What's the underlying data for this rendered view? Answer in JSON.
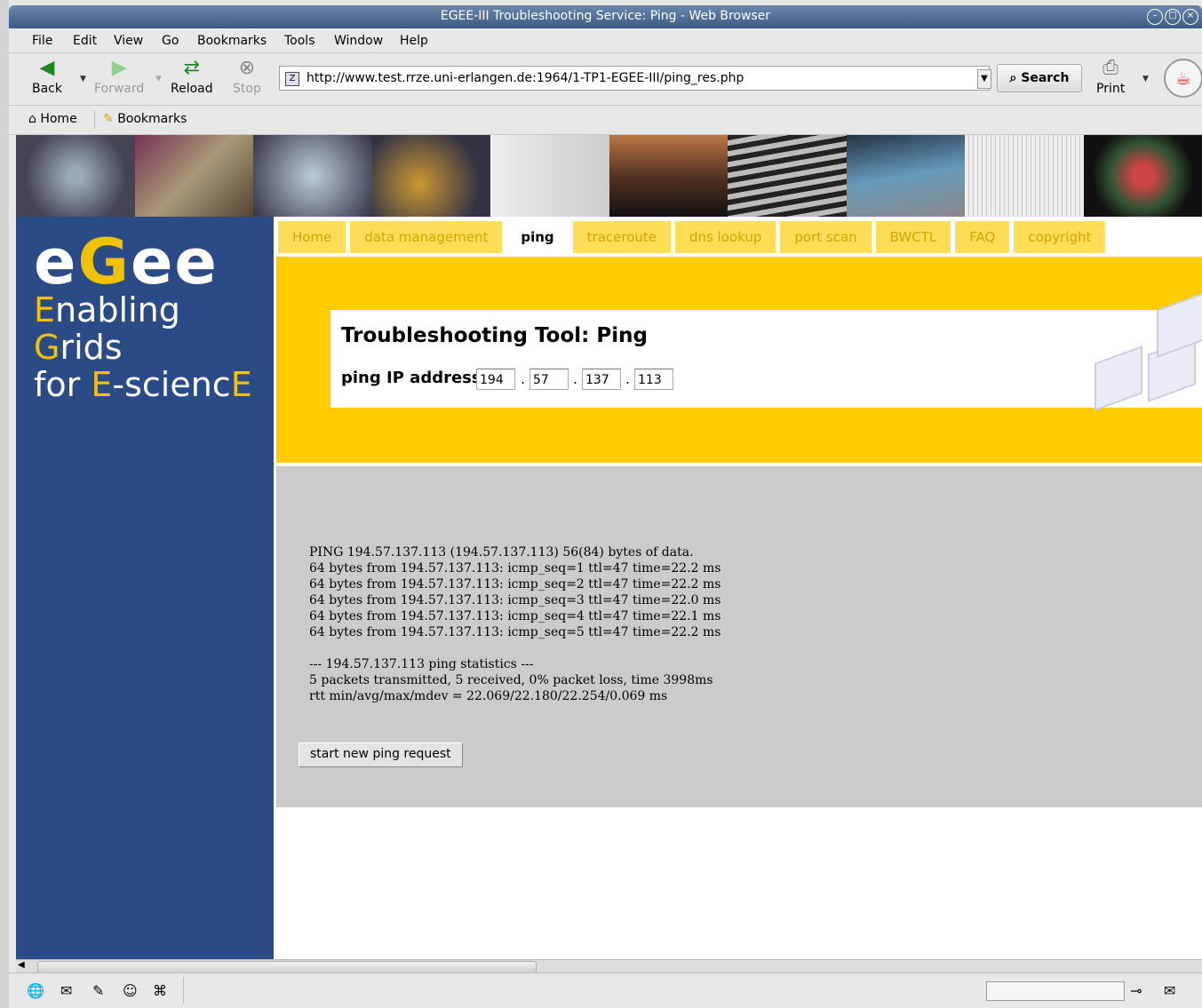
{
  "window": {
    "title": "EGEE-III Troubleshooting Service: Ping - Web Browser",
    "controls": [
      "minimize",
      "maximize",
      "close"
    ]
  },
  "menu": [
    {
      "label": "File"
    },
    {
      "label": "Edit"
    },
    {
      "label": "View"
    },
    {
      "label": "Go"
    },
    {
      "label": "Bookmarks"
    },
    {
      "label": "Tools"
    },
    {
      "label": "Window"
    },
    {
      "label": "Help"
    }
  ],
  "toolbar": {
    "back": "Back",
    "forward": "Forward",
    "reload": "Reload",
    "stop": "Stop",
    "url": "http://www.test.rrze.uni-erlangen.de:1964/1-TP1-EGEE-III/ping_res.php",
    "search": "Search",
    "print": "Print"
  },
  "bookmarks_bar": {
    "home": "Home",
    "bookmarks": "Bookmarks"
  },
  "page": {
    "logo": {
      "text": "egee",
      "line1_first": "E",
      "line1_rest": "nabling ",
      "line1_g": "G",
      "line1_end": "rids",
      "line2_a": "for ",
      "line2_e": "E",
      "line2_mid": "-scienc",
      "line2_end": "E"
    },
    "tabs": [
      {
        "label": "Home",
        "active": false
      },
      {
        "label": "data management",
        "active": false
      },
      {
        "label": "ping",
        "active": true
      },
      {
        "label": "traceroute",
        "active": false
      },
      {
        "label": "dns lookup",
        "active": false
      },
      {
        "label": "port scan",
        "active": false
      },
      {
        "label": "BWCTL",
        "active": false
      },
      {
        "label": "FAQ",
        "active": false
      },
      {
        "label": "copyright",
        "active": false
      }
    ],
    "heading": "Troubleshooting Tool: Ping",
    "ping_label": "ping IP address:",
    "ip": [
      "194",
      "57",
      "137",
      "113"
    ],
    "output": [
      "PING 194.57.137.113 (194.57.137.113) 56(84) bytes of data.",
      "64 bytes from 194.57.137.113: icmp_seq=1 ttl=47 time=22.2 ms",
      "64 bytes from 194.57.137.113: icmp_seq=2 ttl=47 time=22.2 ms",
      "64 bytes from 194.57.137.113: icmp_seq=3 ttl=47 time=22.0 ms",
      "64 bytes from 194.57.137.113: icmp_seq=4 ttl=47 time=22.1 ms",
      "64 bytes from 194.57.137.113: icmp_seq=5 ttl=47 time=22.2 ms",
      "",
      "--- 194.57.137.113 ping statistics ---",
      "5 packets transmitted, 5 received, 0% packet loss, time 3998ms",
      "rtt min/avg/max/mdev = 22.069/22.180/22.254/0.069 ms"
    ],
    "new_request_button": "start new ping request"
  },
  "colors": {
    "sidebar": "#2b4b86",
    "accent_yellow": "#ffcc00",
    "tab_yellow": "#ffde57",
    "output_bg": "#cbcbcb"
  }
}
